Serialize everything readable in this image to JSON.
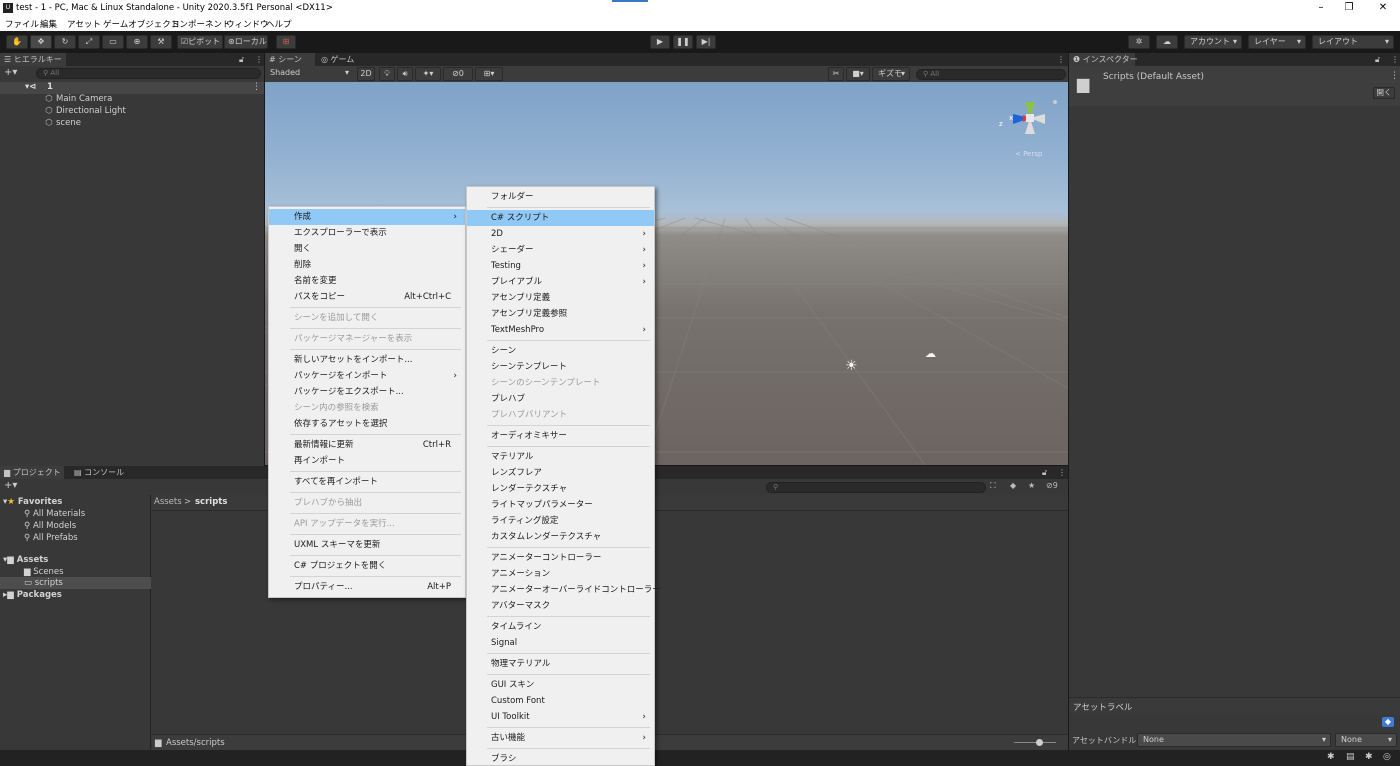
{
  "window": {
    "title": "test - 1 - PC, Mac & Linux Standalone - Unity 2020.3.5f1 Personal <DX11>",
    "app_icon": "unity-icon",
    "minimize": "–",
    "restore": "❐",
    "close": "✕"
  },
  "menubar": [
    "ファイル",
    "編集",
    "アセット",
    "ゲームオブジェクト",
    "コンポーネント",
    "ウィンドウ",
    "ヘルプ"
  ],
  "toolbar": {
    "pivot": "ピボット",
    "local": "ローカル",
    "account": "アカウント",
    "layers": "レイヤー",
    "layout": "レイアウト"
  },
  "hierarchy": {
    "tab": "ヒエラルキー",
    "search_placeholder": "All",
    "scene_name": "1",
    "items": [
      "Main Camera",
      "Directional Light",
      "scene"
    ]
  },
  "scene_view": {
    "tab_scene": "シーン",
    "tab_game": "ゲーム",
    "shading": "Shaded",
    "mode_2d": "2D",
    "hidden_count": "0",
    "gizmos": "ギズモ",
    "search_placeholder": "All",
    "persp": "< Persp",
    "gizmo_x": "x",
    "gizmo_z": "z"
  },
  "inspector": {
    "tab": "インスペクター",
    "title": "Scripts (Default Asset)",
    "open_button": "開く",
    "asset_labels": "アセットラベル",
    "asset_bundle": "アセットバンドル",
    "bundle_value": "None",
    "variant_value": "None"
  },
  "project": {
    "tab_project": "プロジェクト",
    "tab_console": "コンソール",
    "breadcrumb_root": "Assets",
    "breadcrumb_sep": ">",
    "breadcrumb_current": "scripts",
    "hidden_count": "9",
    "footer_path": "Assets/scripts",
    "favorites": "Favorites",
    "favorite_items": [
      "All Materials",
      "All Models",
      "All Prefabs"
    ],
    "assets": "Assets",
    "asset_items": [
      "Scenes",
      "scripts"
    ],
    "packages": "Packages"
  },
  "context_menu": {
    "items": [
      {
        "label": "作成",
        "submenu": true,
        "highlight": true
      },
      {
        "label": "エクスプローラーで表示"
      },
      {
        "label": "開く"
      },
      {
        "label": "削除"
      },
      {
        "label": "名前を変更"
      },
      {
        "label": "パスをコピー",
        "shortcut": "Alt+Ctrl+C"
      },
      {
        "sep": true
      },
      {
        "label": "シーンを追加して開く",
        "disabled": true
      },
      {
        "sep": true
      },
      {
        "label": "パッケージマネージャーを表示",
        "disabled": true
      },
      {
        "sep": true
      },
      {
        "label": "新しいアセットをインポート..."
      },
      {
        "label": "パッケージをインポート",
        "submenu": true
      },
      {
        "label": "パッケージをエクスポート..."
      },
      {
        "label": "シーン内の参照を検索",
        "disabled": true
      },
      {
        "label": "依存するアセットを選択"
      },
      {
        "sep": true
      },
      {
        "label": "最新情報に更新",
        "shortcut": "Ctrl+R"
      },
      {
        "label": "再インポート"
      },
      {
        "sep": true
      },
      {
        "label": "すべてを再インポート"
      },
      {
        "sep": true
      },
      {
        "label": "プレハブから抽出",
        "disabled": true
      },
      {
        "sep": true
      },
      {
        "label": "API アップデータを実行...",
        "disabled": true
      },
      {
        "sep": true
      },
      {
        "label": "UXML スキーマを更新"
      },
      {
        "sep": true
      },
      {
        "label": "C# プロジェクトを開く"
      },
      {
        "sep": true
      },
      {
        "label": "プロパティー...",
        "shortcut": "Alt+P"
      }
    ]
  },
  "create_submenu": {
    "items": [
      {
        "label": "フォルダー"
      },
      {
        "sep": true
      },
      {
        "label": "C# スクリプト",
        "highlight": true
      },
      {
        "label": "2D",
        "submenu": true
      },
      {
        "label": "シェーダー",
        "submenu": true
      },
      {
        "label": "Testing",
        "submenu": true
      },
      {
        "label": "プレイアブル",
        "submenu": true
      },
      {
        "label": "アセンブリ定義"
      },
      {
        "label": "アセンブリ定義参照"
      },
      {
        "label": "TextMeshPro",
        "submenu": true
      },
      {
        "sep": true
      },
      {
        "label": "シーン"
      },
      {
        "label": "シーンテンプレート"
      },
      {
        "label": "シーンのシーンテンプレート",
        "disabled": true
      },
      {
        "label": "プレハブ"
      },
      {
        "label": "プレハブバリアント",
        "disabled": true
      },
      {
        "sep": true
      },
      {
        "label": "オーディオミキサー"
      },
      {
        "sep": true
      },
      {
        "label": "マテリアル"
      },
      {
        "label": "レンズフレア"
      },
      {
        "label": "レンダーテクスチャ"
      },
      {
        "label": "ライトマップパラメーター"
      },
      {
        "label": "ライティング設定"
      },
      {
        "label": "カスタムレンダーテクスチャ"
      },
      {
        "sep": true
      },
      {
        "label": "アニメーターコントローラー"
      },
      {
        "label": "アニメーション"
      },
      {
        "label": "アニメーターオーバーライドコントローラー"
      },
      {
        "label": "アバターマスク"
      },
      {
        "sep": true
      },
      {
        "label": "タイムライン"
      },
      {
        "label": "Signal"
      },
      {
        "sep": true
      },
      {
        "label": "物理マテリアル"
      },
      {
        "sep": true
      },
      {
        "label": "GUI スキン"
      },
      {
        "label": "Custom Font"
      },
      {
        "label": "UI Toolkit",
        "submenu": true
      },
      {
        "sep": true
      },
      {
        "label": "古い機能",
        "submenu": true
      },
      {
        "sep": true
      },
      {
        "label": "ブラシ"
      }
    ]
  },
  "menu_glyphs": {
    "submenu_arrow": "›"
  }
}
